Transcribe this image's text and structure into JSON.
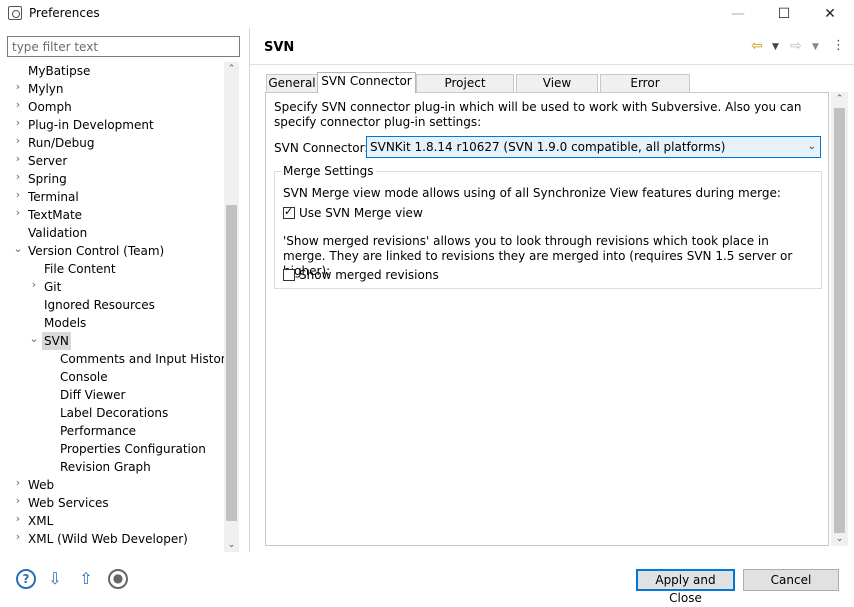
{
  "window": {
    "title": "Preferences",
    "min": "—",
    "max": "☐",
    "close": "✕"
  },
  "filter": {
    "placeholder": "type filter text",
    "value": ""
  },
  "tree": [
    {
      "label": "MyBatipse",
      "level": 0,
      "twisty": ""
    },
    {
      "label": "Mylyn",
      "level": 0,
      "twisty": "›"
    },
    {
      "label": "Oomph",
      "level": 0,
      "twisty": "›"
    },
    {
      "label": "Plug-in Development",
      "level": 0,
      "twisty": "›"
    },
    {
      "label": "Run/Debug",
      "level": 0,
      "twisty": "›"
    },
    {
      "label": "Server",
      "level": 0,
      "twisty": "›"
    },
    {
      "label": "Spring",
      "level": 0,
      "twisty": "›"
    },
    {
      "label": "Terminal",
      "level": 0,
      "twisty": "›"
    },
    {
      "label": "TextMate",
      "level": 0,
      "twisty": "›"
    },
    {
      "label": "Validation",
      "level": 0,
      "twisty": ""
    },
    {
      "label": "Version Control (Team)",
      "level": 0,
      "twisty": "⌄"
    },
    {
      "label": "File Content",
      "level": 1,
      "twisty": ""
    },
    {
      "label": "Git",
      "level": 1,
      "twisty": "›"
    },
    {
      "label": "Ignored Resources",
      "level": 1,
      "twisty": ""
    },
    {
      "label": "Models",
      "level": 1,
      "twisty": ""
    },
    {
      "label": "SVN",
      "level": 1,
      "twisty": "⌄",
      "selected": true
    },
    {
      "label": "Comments and Input History",
      "level": 2,
      "twisty": ""
    },
    {
      "label": "Console",
      "level": 2,
      "twisty": ""
    },
    {
      "label": "Diff Viewer",
      "level": 2,
      "twisty": ""
    },
    {
      "label": "Label Decorations",
      "level": 2,
      "twisty": ""
    },
    {
      "label": "Performance",
      "level": 2,
      "twisty": ""
    },
    {
      "label": "Properties Configuration",
      "level": 2,
      "twisty": ""
    },
    {
      "label": "Revision Graph",
      "level": 2,
      "twisty": ""
    },
    {
      "label": "Web",
      "level": 0,
      "twisty": "›"
    },
    {
      "label": "Web Services",
      "level": 0,
      "twisty": "›"
    },
    {
      "label": "XML",
      "level": 0,
      "twisty": "›"
    },
    {
      "label": "XML (Wild Web Developer)",
      "level": 0,
      "twisty": "›"
    }
  ],
  "page": {
    "title": "SVN"
  },
  "tabs": [
    {
      "label": "General"
    },
    {
      "label": "SVN Connector"
    },
    {
      "label": "Project structure"
    },
    {
      "label": "View Settings"
    },
    {
      "label": "Error Reporting"
    }
  ],
  "connector": {
    "description": "Specify SVN connector plug-in which will be used to work with Subversive. Also you can specify connector plug-in settings:",
    "label": "SVN Connector:",
    "value": "SVNKit 1.8.14 r10627 (SVN 1.9.0 compatible, all platforms)"
  },
  "merge": {
    "title": "Merge Settings",
    "desc1": "SVN Merge view mode allows using of all Synchronize View features during merge:",
    "use_merge_view_label": "Use SVN Merge view",
    "use_merge_view_checked": true,
    "desc2": "'Show merged revisions' allows you to look through revisions which took place in merge. They are linked to revisions they are merged into (requires SVN 1.5 server or higher):",
    "show_merged_label": "Show merged revisions",
    "show_merged_checked": false
  },
  "buttons": {
    "apply_close": "Apply and Close",
    "cancel": "Cancel"
  },
  "icons": [
    "help-icon",
    "import-icon",
    "export-icon",
    "record-icon"
  ]
}
